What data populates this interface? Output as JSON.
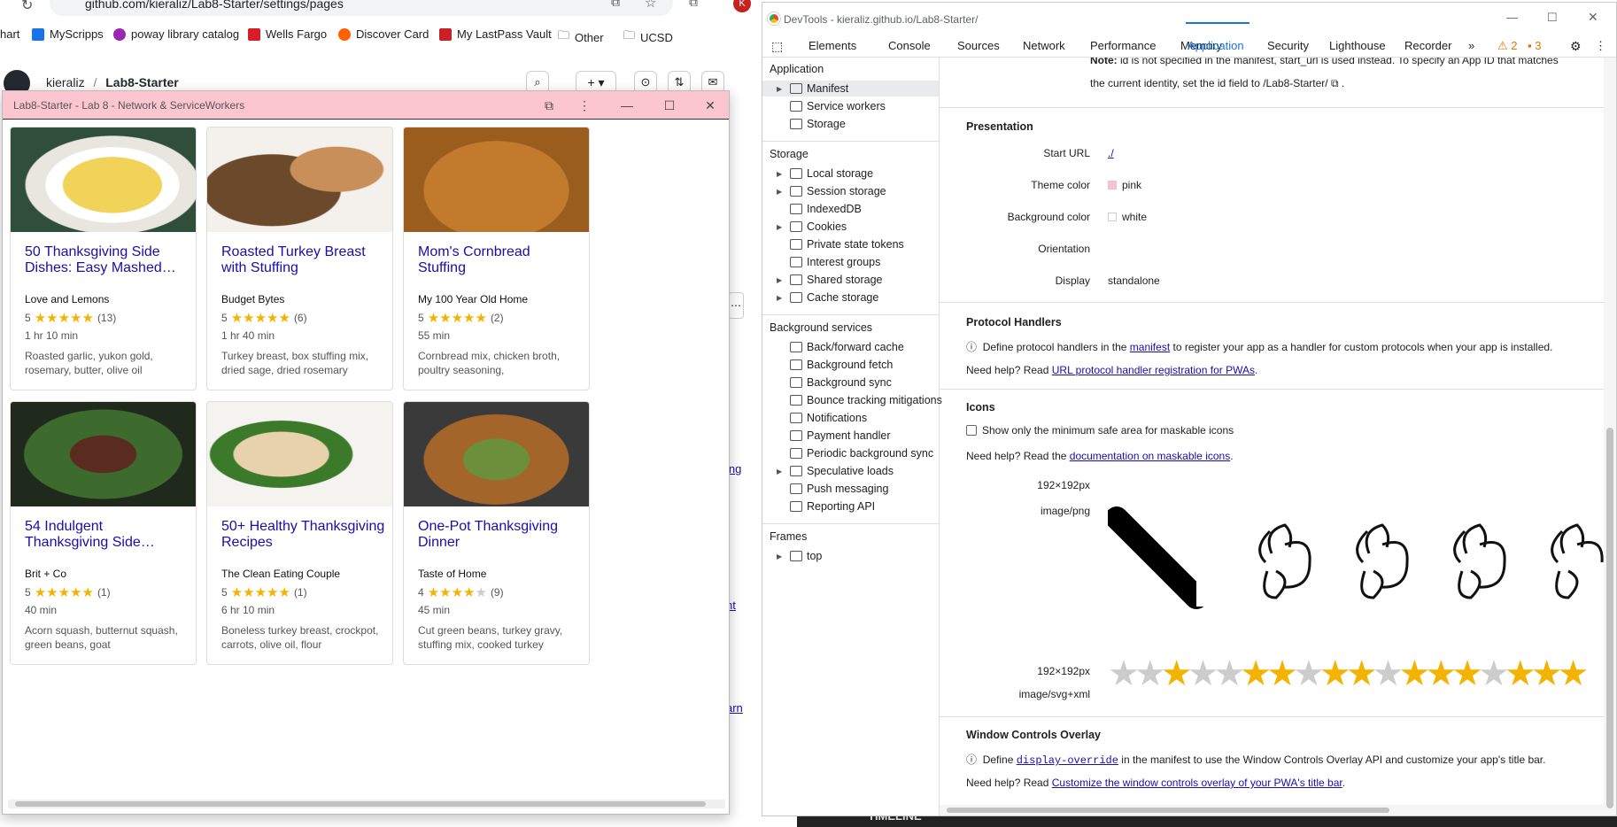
{
  "browser": {
    "url": "github.com/kieraliz/Lab8-Starter/settings/pages",
    "bookmarks": [
      "hart",
      "MyScripps",
      "poway library catalog",
      "Wells Fargo",
      "Discover Card",
      "My LastPass Vault",
      "Other",
      "UCSD"
    ],
    "breadcrumb_owner": "kieraliz",
    "breadcrumb_sep": "/",
    "breadcrumb_repo": "Lab8-Starter",
    "timeline_label": "TIMELINE",
    "right_links": [
      "ing",
      "nt",
      "arn"
    ]
  },
  "pwa": {
    "title": "Lab8-Starter - Lab 8 - Network & ServiceWorkers",
    "colors": {
      "titlebar": "#fcc6d0",
      "link": "#1a0dab",
      "star": "#f5b301"
    },
    "cards": [
      {
        "title": "50 Thanksgiving Side Dishes: Easy Mashed…",
        "org": "Love and Lemons",
        "rating": 5,
        "count": "(13)",
        "time": "1 hr 10 min",
        "ingredients": "Roasted garlic, yukon gold, rosemary, butter, olive oil",
        "img": "mashed-potatoes"
      },
      {
        "title": "Roasted Turkey Breast with Stuffing",
        "org": "Budget Bytes",
        "rating": 5,
        "count": "(6)",
        "time": "1 hr 40 min",
        "ingredients": "Turkey breast, box stuffing mix, dried sage, dried rosemary",
        "img": "turkey-stuffing"
      },
      {
        "title": "Mom's Cornbread Stuffing",
        "org": "My 100 Year Old Home",
        "rating": 5,
        "count": "(2)",
        "time": "55 min",
        "ingredients": "Cornbread mix, chicken broth, poultry seasoning,",
        "img": "cornbread-stuffing"
      },
      {
        "title": "54 Indulgent Thanksgiving Side…",
        "org": "Brit + Co",
        "rating": 5,
        "count": "(1)",
        "time": "40 min",
        "ingredients": "Acorn squash, butternut squash, green beans, goat",
        "img": "green-beans-pecans"
      },
      {
        "title": "50+ Healthy Thanksgiving Recipes",
        "org": "The Clean Eating Couple",
        "rating": 5,
        "count": "(1)",
        "time": "6 hr 10 min",
        "ingredients": "Boneless turkey breast, crockpot, carrots, olive oil, flour",
        "img": "turkey-plate"
      },
      {
        "title": "One-Pot Thanksgiving Dinner",
        "org": "Taste of Home",
        "rating": 4,
        "count": "(9)",
        "time": "45 min",
        "ingredients": "Cut green beans, turkey gravy, stuffing mix, cooked turkey",
        "img": "one-pot"
      }
    ]
  },
  "devtools": {
    "title": "DevTools - kieraliz.github.io/Lab8-Starter/",
    "tabs": [
      "Elements",
      "Console",
      "Sources",
      "Network",
      "Performance",
      "Memory",
      "Application",
      "Security",
      "Lighthouse",
      "Recorder"
    ],
    "active_tab": "Application",
    "warn_count": "2",
    "issue_count": "3",
    "sidebar": {
      "application_header": "Application",
      "application_items": [
        "Manifest",
        "Service workers",
        "Storage"
      ],
      "storage_header": "Storage",
      "storage_items": [
        "Local storage",
        "Session storage",
        "IndexedDB",
        "Cookies",
        "Private state tokens",
        "Interest groups",
        "Shared storage",
        "Cache storage"
      ],
      "bg_header": "Background services",
      "bg_items": [
        "Back/forward cache",
        "Background fetch",
        "Background sync",
        "Bounce tracking mitigations",
        "Notifications",
        "Payment handler",
        "Periodic background sync",
        "Speculative loads",
        "Push messaging",
        "Reporting API"
      ],
      "frames_header": "Frames",
      "frames_items": [
        "top"
      ]
    },
    "main": {
      "note_line1_bold": "Note:",
      "note_line1": " id is not specified in the manifest, start_url is used instead. To specify an App ID that matches",
      "note_line2": "the current identity, set the id field to /Lab8-Starter/",
      "presentation_header": "Presentation",
      "start_url_label": "Start URL",
      "start_url_value": "./",
      "theme_color_label": "Theme color",
      "theme_color_value": "pink",
      "bg_color_label": "Background color",
      "bg_color_value": "white",
      "orientation_label": "Orientation",
      "display_label": "Display",
      "display_value": "standalone",
      "protocol_header": "Protocol Handlers",
      "protocol_text_a": "Define protocol handlers in the ",
      "protocol_link": "manifest",
      "protocol_text_b": " to register your app as a handler for custom protocols when your app is installed.",
      "protocol_help": "Need help? Read ",
      "protocol_help_link": "URL protocol handler registration for PWAs",
      "icons_header": "Icons",
      "icons_checkbox": "Show only the minimum safe area for maskable icons",
      "icons_help": "Need help? Read the ",
      "icons_help_link": "documentation on maskable icons",
      "icon1_size": "192×192px",
      "icon1_type": "image/png",
      "icon2_size": "192×192px",
      "icon2_type": "image/svg+xml",
      "wco_header": "Window Controls Overlay",
      "wco_text_a": "Define ",
      "wco_link": "display-override",
      "wco_text_b": " in the manifest to use the Window Controls Overlay API and customize your app's title bar.",
      "wco_help": "Need help? Read ",
      "wco_help_link": "Customize the window controls overlay of your PWA's title bar"
    }
  }
}
